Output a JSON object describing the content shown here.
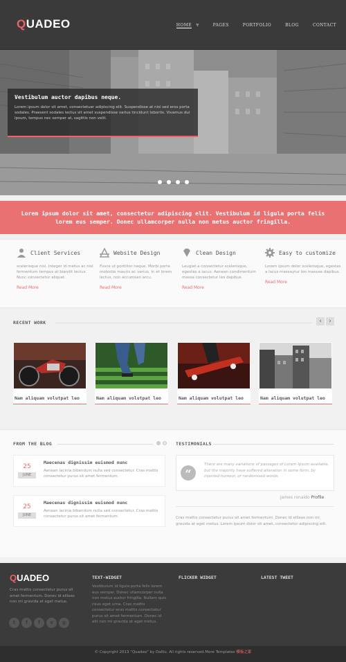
{
  "header": {
    "logo_first": "Q",
    "logo_rest": "UADEO",
    "nav": [
      "HOME",
      "PAGES",
      "PORTFOLIO",
      "BLOG",
      "CONTACT"
    ]
  },
  "slider": {
    "caption_title": "Vestibulum auctor dapibus neque.",
    "caption_text": "Lorem ipsum dolor sit amet, consectetuer adipiscing elit. Suspendisse at nisi sed eros porta sodales. Praesent sodales lectus sit amet suspendisse varius tincidunt lobortis. Vivamus dui ipsum, tempus nec semper at, sagittis non velit.",
    "slides": 4
  },
  "banner": {
    "line1": "Lorem ipsum dolor sit amet, consectetur adipiscing elit. Vestibulum id ligula porta felis",
    "line2": "lorem eus semper. Donec ullamcorper nulla non metus auctor fringilla."
  },
  "features": [
    {
      "title": "Client Services",
      "icon": "user-icon",
      "text": "scelerisque nisi. Integer id metus ac nisl fermentum tempus at blandit lectus. Nunc consectetur aliquet.",
      "link": "Read More"
    },
    {
      "title": "Website Design",
      "icon": "design-icon",
      "text": "Fusce ut porttitor neque. Morbi porta molestie mauris ac varius. In et lorem lectus, non accumsan arcu.",
      "link": "Read More"
    },
    {
      "title": "Clean Design",
      "icon": "diamond-icon",
      "text": "Leugiat a consectetur scelerisque, egestas a lacus. Aenean condimentum massa consectetur leo dapibus.",
      "link": "Read More"
    },
    {
      "title": "Easy to customize",
      "icon": "gear-icon",
      "text": "Lorem ipsum dolor scelerisque, egestas a lacus massaytur leo massae dapibus.",
      "link": "Read More"
    }
  ],
  "recent_work": {
    "title": "RECENT WORK",
    "prev": "‹",
    "next": "›",
    "items": [
      {
        "caption": "Nam aliquam volutpat leo",
        "image": "motorcycle"
      },
      {
        "caption": "Nam aliquam volutpat leo",
        "image": "jeans-stairs"
      },
      {
        "caption": "Nam aliquam volutpat leo",
        "image": "skateboard"
      },
      {
        "caption": "Nam aliquam volutpat leo",
        "image": "city-buildings"
      }
    ]
  },
  "blog": {
    "title": "FROM THE BLOG",
    "posts": [
      {
        "day": "25",
        "month": "JUNE",
        "title": "Maecenas dignissim euismod nunc",
        "text": "Aenean lacinia bibendum nulla sed consectetur. Cras mattis consectetur purus sit amet fermentum."
      },
      {
        "day": "25",
        "month": "JUNE",
        "title": "Maecenas dignissim euismod nunc",
        "text": "Aenean lacinia bibendum nulla sed consectetur. Cras mattis consectetur purus sit amet fermentum."
      }
    ]
  },
  "testimonials": {
    "title": "TESTIMONIALS",
    "quote": "There are many variations of passages of Lorem Ipsum available, but the majority have suffered alteration in some form, by injected humour, or randomised words.",
    "author_name": "James ronaldo",
    "author_role": "Profile",
    "text": "Cras mattis consectetur purus sit amet fermentum. Donec id elileas non mi gravida at eget metus. Lorem ipsum dolor sit amet, consectetur adipiscing elit."
  },
  "footer": {
    "logo_first": "Q",
    "logo_rest": "UADEO",
    "about": "Cras mattis consectetur purus sit amet fermentum. Donec id elileas non mi gravida at eget metus.",
    "socials": [
      "t",
      "f",
      "f",
      "v",
      "g"
    ],
    "text_widget_title": "TEXT-WIDGET",
    "text_widget": "Vestibulum id ligula porta felis lorem eus semper. Donec ullamcorper nulla non metus auctor fringilla. Nullam quis risus eget urna. Cras mattis consectetur eras mattis consectetur purus sit amet fermentum. Donec id elit non mi gravida at eget metus.",
    "flickr_title": "FLICKER WIDGET",
    "tweet_title": "LATEST TWEET",
    "copyright": "© Copyright 2013 \"Quadeo\" by Dalliu. All rights reserved.More Templates",
    "copyright_link": "模板之家"
  }
}
